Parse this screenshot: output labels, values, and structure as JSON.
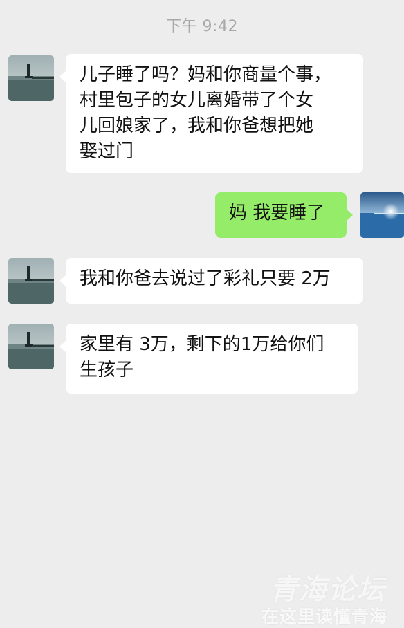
{
  "chat": {
    "timestamp": "下午 9:42",
    "messages": [
      {
        "sender": "mother",
        "side": "left",
        "lines": [
          "儿子睡了吗？妈和你商量个事，",
          "村里包子的女儿离婚带了个女",
          "儿回娘家了，我和你爸想把她",
          "娶过门"
        ]
      },
      {
        "sender": "son",
        "side": "right",
        "lines": [
          "妈 我要睡了"
        ]
      },
      {
        "sender": "mother",
        "side": "left",
        "lines": [
          "我和你爸去说过了彩礼只要 2万"
        ]
      },
      {
        "sender": "mother",
        "side": "left",
        "lines": [
          "家里有 3万，剩下的1万给你们",
          "生孩子"
        ]
      }
    ]
  },
  "avatars": {
    "mother": "lighthouse-sea-photo-icon",
    "son": "sunset-sea-photo-icon"
  },
  "watermark": {
    "title": "青海论坛",
    "subtitle": "在这里读懂青海"
  },
  "colors": {
    "background": "#ededed",
    "left_bubble": "#ffffff",
    "right_bubble": "#95ec69",
    "timestamp_text": "#a8a8a8"
  }
}
